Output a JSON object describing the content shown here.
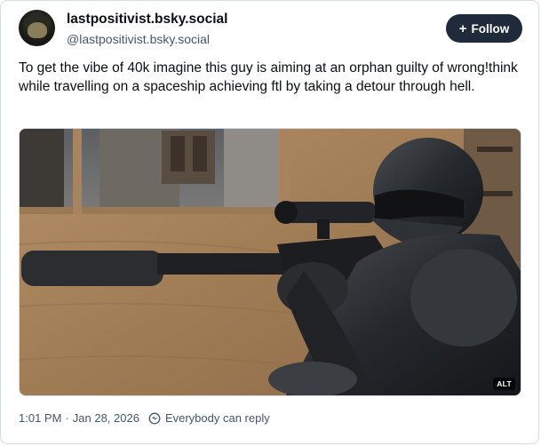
{
  "post": {
    "author": {
      "display_name": "lastpositivist.bsky.social",
      "handle": "@lastpositivist.bsky.social"
    },
    "follow_label": "Follow",
    "text": "To get the vibe of 40k imagine this guy is aiming at an orphan guilty of wrong!think while travelling on a spaceship achieving ftl by taking a detour through hell.",
    "image": {
      "alt_badge": "ALT"
    },
    "meta": {
      "time": "1:01 PM",
      "separator": "·",
      "date": "Jan 28, 2026",
      "reply_setting": "Everybody can reply"
    }
  },
  "colors": {
    "follow_button_bg": "#1f2b3a",
    "secondary_text": "#42576c",
    "border": "#d4dbe2"
  },
  "icons": {
    "plus": "plus-icon",
    "reply_setting": "globe-icon"
  }
}
